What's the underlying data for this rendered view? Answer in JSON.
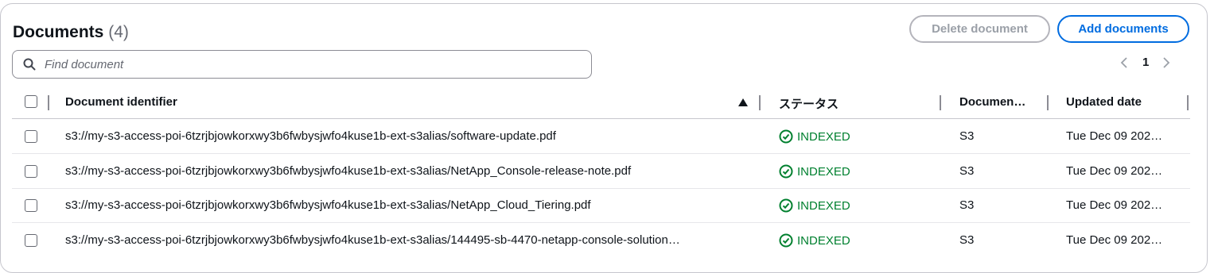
{
  "header": {
    "title": "Documents",
    "count": "(4)"
  },
  "actions": {
    "delete_label": "Delete document",
    "add_label": "Add documents"
  },
  "search": {
    "placeholder": "Find document"
  },
  "pagination": {
    "current_page": "1"
  },
  "table": {
    "columns": {
      "identifier": "Document identifier",
      "status": "ステータス",
      "source": "Documen…",
      "updated": "Updated date"
    },
    "sort": {
      "column": "identifier",
      "direction": "ascending"
    },
    "rows": [
      {
        "identifier": "s3://my-s3-access-poi-6tzrjbjowkorxwy3b6fwbysjwfo4kuse1b-ext-s3alias/software-update.pdf",
        "status": "INDEXED",
        "source": "S3",
        "updated": "Tue Dec 09 202…"
      },
      {
        "identifier": "s3://my-s3-access-poi-6tzrjbjowkorxwy3b6fwbysjwfo4kuse1b-ext-s3alias/NetApp_Console-release-note.pdf",
        "status": "INDEXED",
        "source": "S3",
        "updated": "Tue Dec 09 202…"
      },
      {
        "identifier": "s3://my-s3-access-poi-6tzrjbjowkorxwy3b6fwbysjwfo4kuse1b-ext-s3alias/NetApp_Cloud_Tiering.pdf",
        "status": "INDEXED",
        "source": "S3",
        "updated": "Tue Dec 09 202…"
      },
      {
        "identifier": "s3://my-s3-access-poi-6tzrjbjowkorxwy3b6fwbysjwfo4kuse1b-ext-s3alias/144495-sb-4470-netapp-console-solution…",
        "status": "INDEXED",
        "source": "S3",
        "updated": "Tue Dec 09 202…"
      }
    ]
  },
  "colors": {
    "accent": "#006ce0",
    "success": "#00802f",
    "disabled": "#9ba0a8",
    "border": "#c6c6cd"
  },
  "icons": {
    "search": "search-icon",
    "status": "check-circle-icon",
    "prev": "chevron-left-icon",
    "next": "chevron-right-icon",
    "sort": "sort-ascending-icon"
  }
}
